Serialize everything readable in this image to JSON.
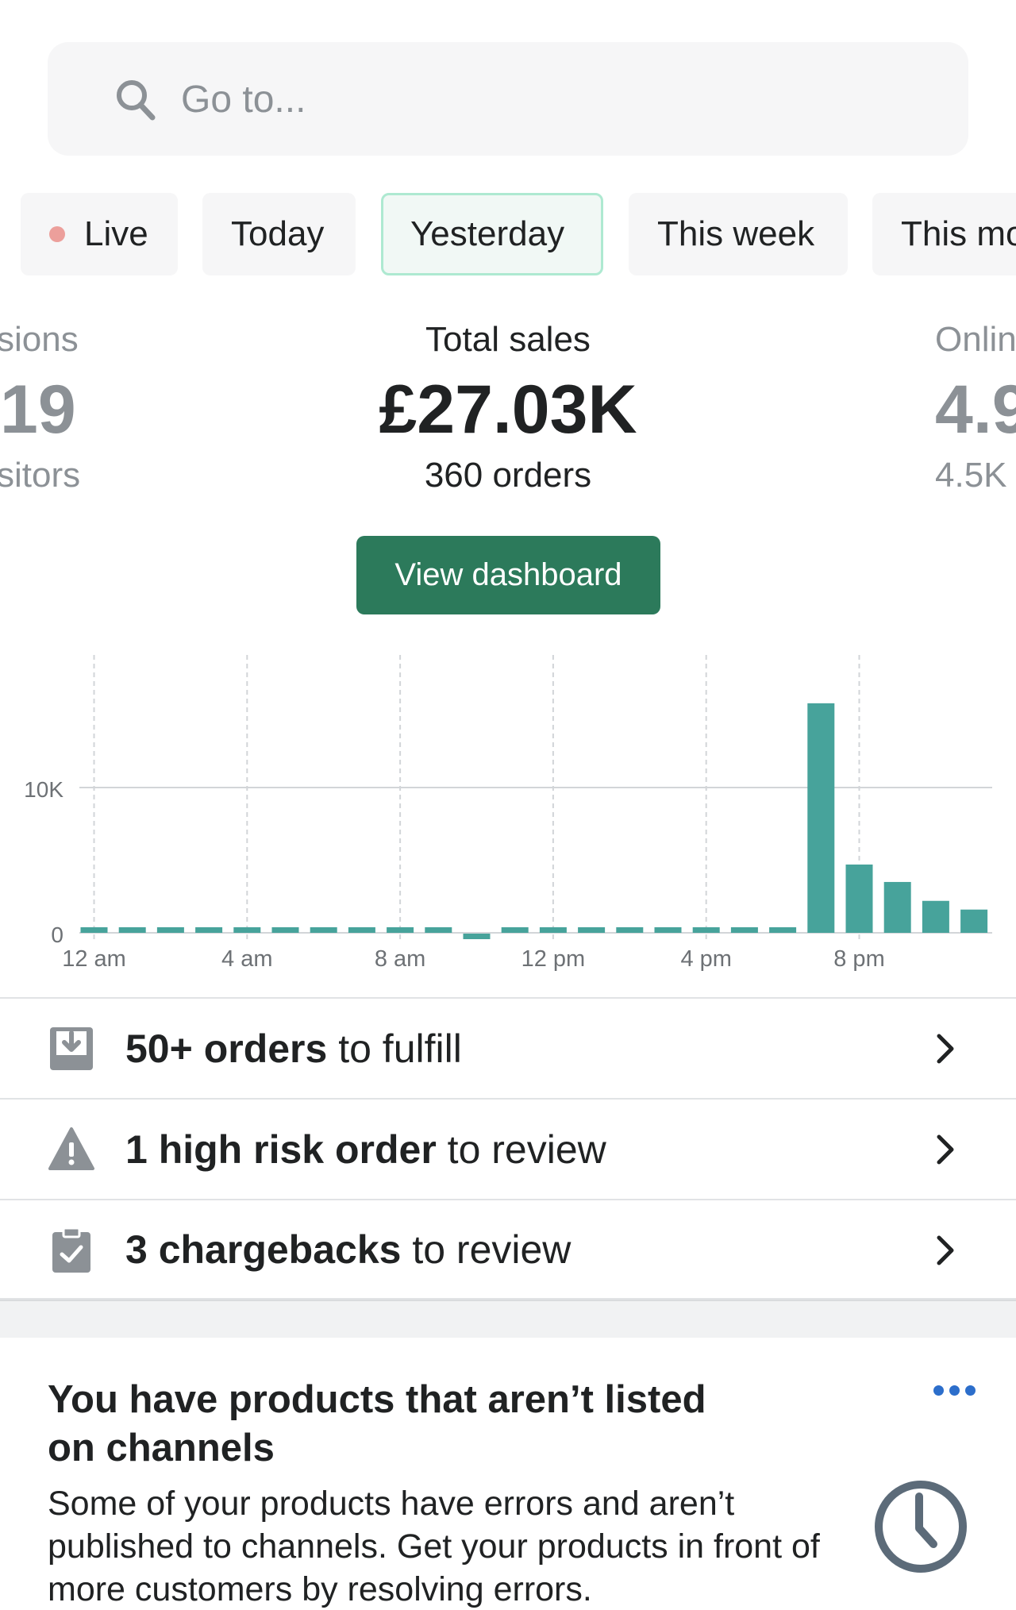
{
  "search": {
    "placeholder": "Go to..."
  },
  "tabs": [
    {
      "label": "Live",
      "active": false
    },
    {
      "label": "Today",
      "active": false
    },
    {
      "label": "Yesterday",
      "active": true
    },
    {
      "label": "This week",
      "active": false
    },
    {
      "label": "This mo",
      "active": false
    }
  ],
  "metrics": {
    "left": {
      "label": "sions",
      "value": "19",
      "sub": "sitors"
    },
    "center": {
      "label": "Total sales",
      "value": "£27.03K",
      "sub": "360 orders"
    },
    "right": {
      "label": "Onlin",
      "value": "4.9",
      "sub": "4.5K"
    }
  },
  "dashboard_button": "View dashboard",
  "chart_data": {
    "type": "bar",
    "categories": [
      "12 am",
      "1 am",
      "2 am",
      "3 am",
      "4 am",
      "5 am",
      "6 am",
      "7 am",
      "8 am",
      "9 am",
      "10 am",
      "11 am",
      "12 pm",
      "1 pm",
      "2 pm",
      "3 pm",
      "4 pm",
      "5 pm",
      "6 pm",
      "7 pm",
      "8 pm",
      "9 pm",
      "10 pm",
      "11 pm"
    ],
    "values": [
      80,
      80,
      80,
      80,
      80,
      80,
      80,
      80,
      80,
      80,
      -80,
      80,
      80,
      80,
      80,
      80,
      80,
      80,
      80,
      15800,
      4700,
      3500,
      2200,
      1600
    ],
    "x_tick_labels": [
      "12 am",
      "4 am",
      "8 am",
      "12 pm",
      "4 pm",
      "8 pm"
    ],
    "y_tick_labels": [
      "0",
      "10K"
    ],
    "y_ticks": [
      0,
      10000
    ],
    "ylim": [
      -500,
      18500
    ],
    "bar_color": "#47a39b",
    "grid": true
  },
  "tasks": [
    {
      "bold": "50+ orders",
      "rest": " to fulfill",
      "icon": "download-box-icon"
    },
    {
      "bold": "1 high risk order",
      "rest": " to review",
      "icon": "warning-icon"
    },
    {
      "bold": "3 chargebacks",
      "rest": " to review",
      "icon": "clipboard-check-icon"
    }
  ],
  "card": {
    "title": "You have products that aren’t listed on channels",
    "body": "Some of your products have errors and aren’t published to channels. Get your products in front of more customers by resolving errors."
  },
  "colors": {
    "accent": "#2c7a5b",
    "bars": "#47a39b",
    "link": "#2c6ecb",
    "muted": "#8c9196"
  }
}
